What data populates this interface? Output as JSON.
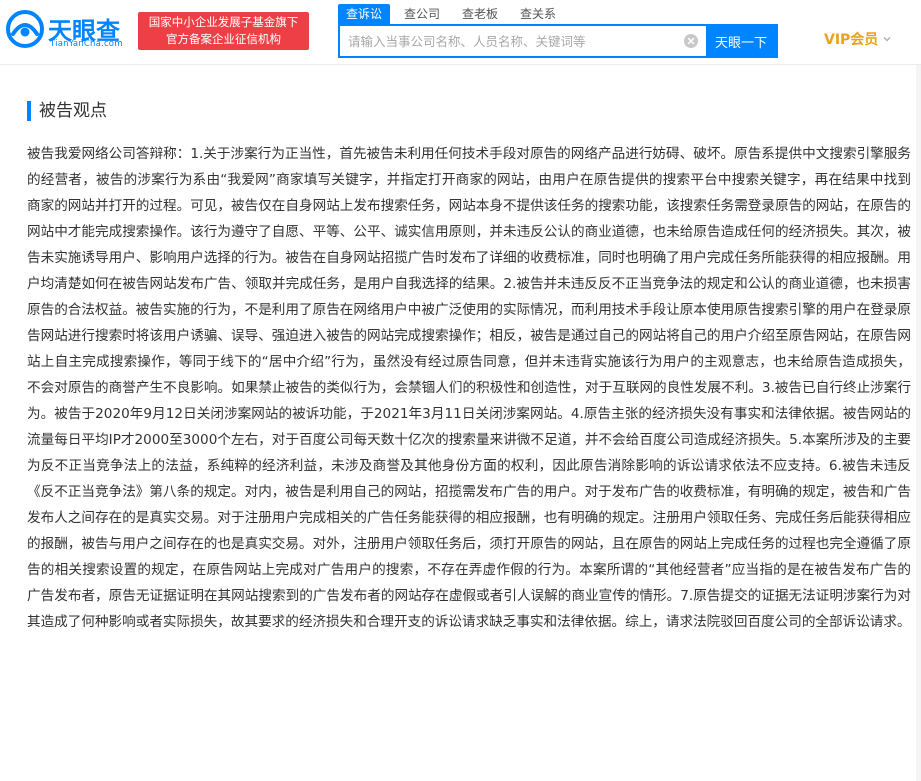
{
  "header": {
    "logo_text": "天眼查",
    "logo_domain": "TianYanCha.com",
    "badge_line1": "国家中小企业发展子基金旗下",
    "badge_line2": "官方备案企业征信机构",
    "vip_label": "VIP会员"
  },
  "search": {
    "tabs": [
      {
        "label": "查诉讼",
        "active": true
      },
      {
        "label": "查公司",
        "active": false
      },
      {
        "label": "查老板",
        "active": false
      },
      {
        "label": "查关系",
        "active": false
      }
    ],
    "placeholder": "请输入当事公司名称、人员名称、关键词等",
    "value": "",
    "button_label": "天眼一下"
  },
  "section": {
    "title": "被告观点",
    "body": "被告我爱网络公司答辩称：1.关于涉案行为正当性，首先被告未利用任何技术手段对原告的网络产品进行妨碍、破坏。原告系提供中文搜索引擎服务的经营者，被告的涉案行为系由“我爱网”商家填写关键字，并指定打开商家的网站，由用户在原告提供的搜索平台中搜索关键字，再在结果中找到商家的网站并打开的过程。可见，被告仅在自身网站上发布搜索任务，网站本身不提供该任务的搜索功能，该搜索任务需登录原告的网站，在原告的网站中才能完成搜索操作。该行为遵守了自愿、平等、公平、诚实信用原则，并未违反公认的商业道德，也未给原告造成任何的经济损失。其次，被告未实施诱导用户、影响用户选择的行为。被告在自身网站招揽广告时发布了详细的收费标准，同时也明确了用户完成任务所能获得的相应报酬。用户均清楚如何在被告网站发布广告、领取并完成任务，是用户自我选择的结果。2.被告并未违反反不正当竞争法的规定和公认的商业道德，也未损害原告的合法权益。被告实施的行为，不是利用了原告在网络用户中被广泛使用的实际情况，而利用技术手段让原本使用原告搜索引擎的用户在登录原告网站进行搜索时将该用户诱骗、误导、强迫进入被告的网站完成搜索操作；相反，被告是通过自己的网站将自己的用户介绍至原告网站，在原告网站上自主完成搜索操作，等同于线下的“居中介绍”行为，虽然没有经过原告同意，但并未违背实施该行为用户的主观意志，也未给原告造成损失，不会对原告的商誉产生不良影响。如果禁止被告的类似行为，会禁锢人们的积极性和创造性，对于互联网的良性发展不利。3.被告已自行终止涉案行为。被告于2020年9月12日关闭涉案网站的被诉功能，于2021年3月11日关闭涉案网站。4.原告主张的经济损失没有事实和法律依据。被告网站的流量每日平均IP才2000至3000个左右，对于百度公司每天数十亿次的搜索量来讲微不足道，并不会给百度公司造成经济损失。5.本案所涉及的主要为反不正当竞争法上的法益，系纯粹的经济利益，未涉及商誉及其他身份方面的权利，因此原告消除影响的诉讼请求依法不应支持。6.被告未违反《反不正当竞争法》第八条的规定。对内，被告是利用自己的网站，招揽需发布广告的用户。对于发布广告的收费标准，有明确的规定，被告和广告发布人之间存在的是真实交易。对于注册用户完成相关的广告任务能获得的相应报酬，也有明确的规定。注册用户领取任务、完成任务后能获得相应的报酬，被告与用户之间存在的也是真实交易。对外，注册用户领取任务后，须打开原告的网站，且在原告的网站上完成任务的过程也完全遵循了原告的相关搜索设置的规定，在原告网站上完成对广告用户的搜索，不存在弄虚作假的行为。本案所谓的“其他经营者”应当指的是在被告发布广告的广告发布者，原告无证据证明在其网站搜索到的广告发布者的网站存在虚假或者引人误解的商业宣传的情形。7.原告提交的证据无法证明涉案行为对其造成了何种影响或者实际损失，故其要求的经济损失和合理开支的诉讼请求缺乏事实和法律依据。综上，请求法院驳回百度公司的全部诉讼请求。"
  },
  "colors": {
    "brand_blue": "#0084ff",
    "badge_red": "#ef3f46",
    "vip_gold": "#e8a21b"
  },
  "icons": {
    "logo": "eye-logo-icon",
    "clear": "clear-circle-icon",
    "vip_dropdown": "chevron-down-icon"
  }
}
